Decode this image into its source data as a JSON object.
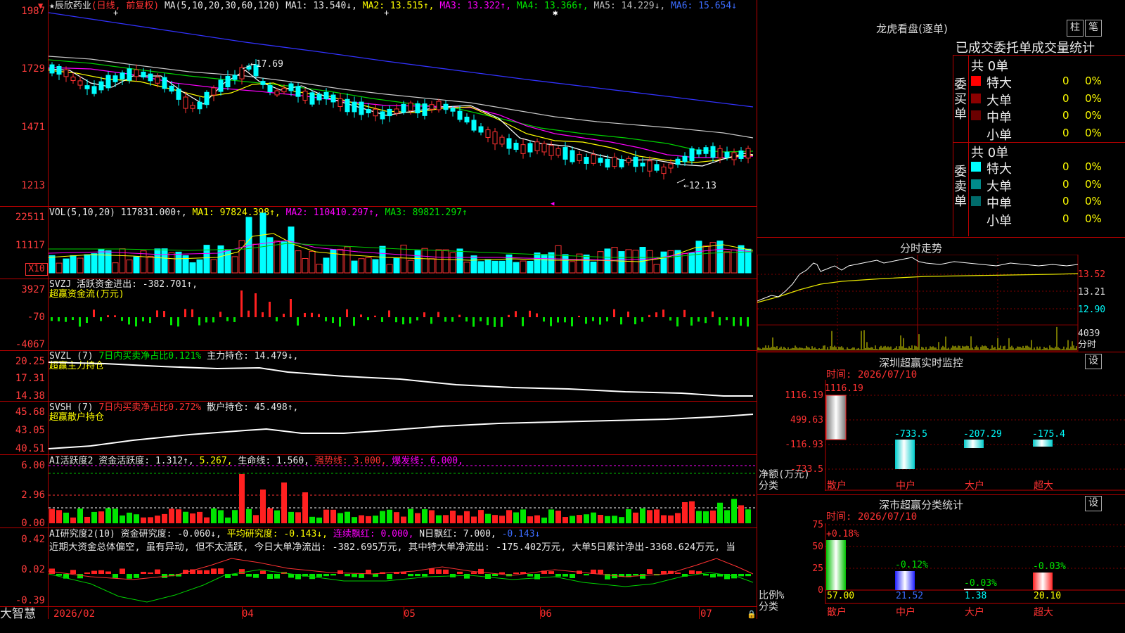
{
  "main": {
    "stock_name": "辰欣药业",
    "period_label": "(日线, 前复权)",
    "ma_params": "MA(5,10,20,30,60,120)",
    "ma1": "MA1: 13.540↓,",
    "ma2": "MA2: 13.515↑,",
    "ma3": "MA3: 13.322↑,",
    "ma4": "MA4: 13.366↑,",
    "ma5": "MA5: 14.229↓,",
    "ma6": "MA6: 15.654↓",
    "y_ticks": [
      "1987",
      "1729",
      "1471",
      "1213"
    ],
    "high_label": "←17.69",
    "low_label": "←12.13"
  },
  "vol": {
    "header": "VOL(5,10,20)",
    "value": "117831.000↑,",
    "ma1": "MA1: 97824.398↑,",
    "ma2": "MA2: 110410.297↑,",
    "ma3": "MA3: 89821.297↑",
    "y_ticks": [
      "22511",
      "11117"
    ],
    "unit": "X10"
  },
  "svzj": {
    "header": "SVZJ  活跃资金进出: -382.701↑,",
    "sub": "超赢资金流(万元)",
    "y_ticks": [
      "3927",
      "-70",
      "-4067"
    ]
  },
  "svzl": {
    "header_a": "SVZL (7)",
    "header_b": "7日内买卖净占比0.121%",
    "header_c": "主力持仓: 14.479↓,",
    "sub": "超赢主力持仓",
    "y_ticks": [
      "20.25",
      "17.31",
      "14.38"
    ]
  },
  "svsh": {
    "header_a": "SVSH (7)",
    "header_b": "7日内买卖净占比0.272%",
    "header_c": "散户持仓: 45.498↑,",
    "sub": "超赢散户持仓",
    "y_ticks": [
      "45.68",
      "43.05",
      "40.51"
    ]
  },
  "ai1": {
    "header_a": "AI活跃度2 资金活跃度: 1.312↑,",
    "header_b": "5.267,",
    "header_c": "生命线: 1.560,",
    "header_d": "强势线: 3.000,",
    "header_e": "爆发线: 6.000,",
    "y_ticks": [
      "6.00",
      "2.96",
      "0.00"
    ]
  },
  "ai2": {
    "header_a": "AI研究度2(10) 资金研究度: -0.060↓,",
    "header_b": "平均研究度: -0.143↓,",
    "header_c": "连续飘红: 0.000,",
    "header_d": "N日飘红: 7.000,",
    "header_e": "-0.143↓",
    "commentary": "近期大资金总体偏空, 虽有异动, 但不太活跃, 今日大单净流出: -382.695万元, 其中特大单净流出: -175.402万元, 大单5日累计净出-3368.624万元, 当",
    "y_ticks": [
      "0.42",
      "0.02",
      "-0.39"
    ]
  },
  "xaxis": {
    "labels": [
      "2026/02",
      "04",
      "05",
      "06",
      "07"
    ],
    "brand": "大智慧"
  },
  "dragon": {
    "title": "龙虎看盘(逐单)",
    "btn1": "柱",
    "btn2": "笔",
    "subtitle": "已成交委托单成交量统计",
    "buy_label": "委买单",
    "sell_label": "委卖单",
    "buy_total": "共 0单",
    "sell_total": "共 0单",
    "buy_rows": [
      {
        "name": "特大",
        "count": "0",
        "pct": "0%",
        "color": "#ff0000"
      },
      {
        "name": "大单",
        "count": "0",
        "pct": "0%",
        "color": "#8b0000"
      },
      {
        "name": "中单",
        "count": "0",
        "pct": "0%",
        "color": "#6b0000"
      },
      {
        "name": "小单",
        "count": "0",
        "pct": "0%",
        "color": ""
      }
    ],
    "sell_rows": [
      {
        "name": "特大",
        "count": "0",
        "pct": "0%",
        "color": "#00ffff"
      },
      {
        "name": "大单",
        "count": "0",
        "pct": "0%",
        "color": "#008b8b"
      },
      {
        "name": "中单",
        "count": "0",
        "pct": "0%",
        "color": "#006b6b"
      },
      {
        "name": "小单",
        "count": "0",
        "pct": "0%",
        "color": ""
      }
    ]
  },
  "intraday": {
    "title": "分时走势",
    "prices": [
      "13.52",
      "13.21",
      "12.90"
    ],
    "vol_label": "4039",
    "vol_unit": "分时"
  },
  "monitor": {
    "title": "深圳超赢实时监控",
    "setting": "设",
    "time": "时间: 2026/07/10",
    "y_ticks": [
      "1116.19",
      "499.63",
      "-116.93",
      "-733.5"
    ],
    "unit_a": "净额(万元)",
    "unit_b": "分类",
    "bars": [
      {
        "cat": "散户",
        "value": "1116.19"
      },
      {
        "cat": "中户",
        "value": "-733.5"
      },
      {
        "cat": "大户",
        "value": "-207.29"
      },
      {
        "cat": "超大",
        "value": "-175.4"
      }
    ]
  },
  "classify": {
    "title": "深市超赢分类统计",
    "setting": "设",
    "time": "时间: 2026/07/10",
    "y_ticks": [
      "75",
      "50",
      "25",
      "0"
    ],
    "unit_a": "比例%",
    "unit_b": "分类",
    "bars": [
      {
        "cat": "散户",
        "change": "+0.18%",
        "ratio": "57.00"
      },
      {
        "cat": "中户",
        "change": "-0.12%",
        "ratio": "21.52"
      },
      {
        "cat": "大户",
        "change": "-0.03%",
        "ratio": "1.38"
      },
      {
        "cat": "超大",
        "change": "-0.03%",
        "ratio": "20.10"
      }
    ]
  }
}
